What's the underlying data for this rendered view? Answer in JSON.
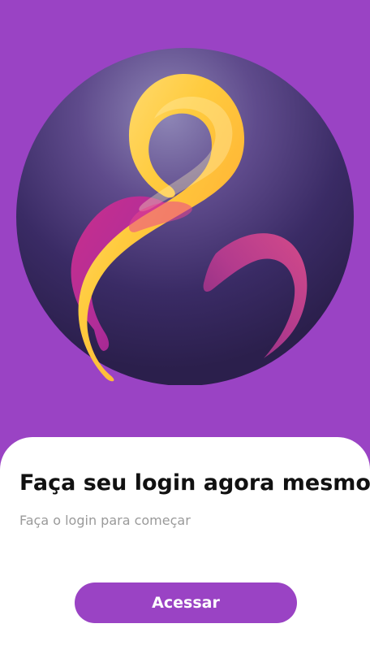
{
  "login": {
    "title": "Faça seu login agora mesmo!",
    "subtitle": "Faça o login para começar",
    "button_label": "Acessar"
  },
  "theme": {
    "background": "#9a43c4",
    "card": "#ffffff",
    "button": "#9a43c4",
    "title_color": "#111111",
    "subtitle_color": "#9a9a9a"
  },
  "icons": {
    "logo": "figure-eight-ribbon-logo"
  }
}
